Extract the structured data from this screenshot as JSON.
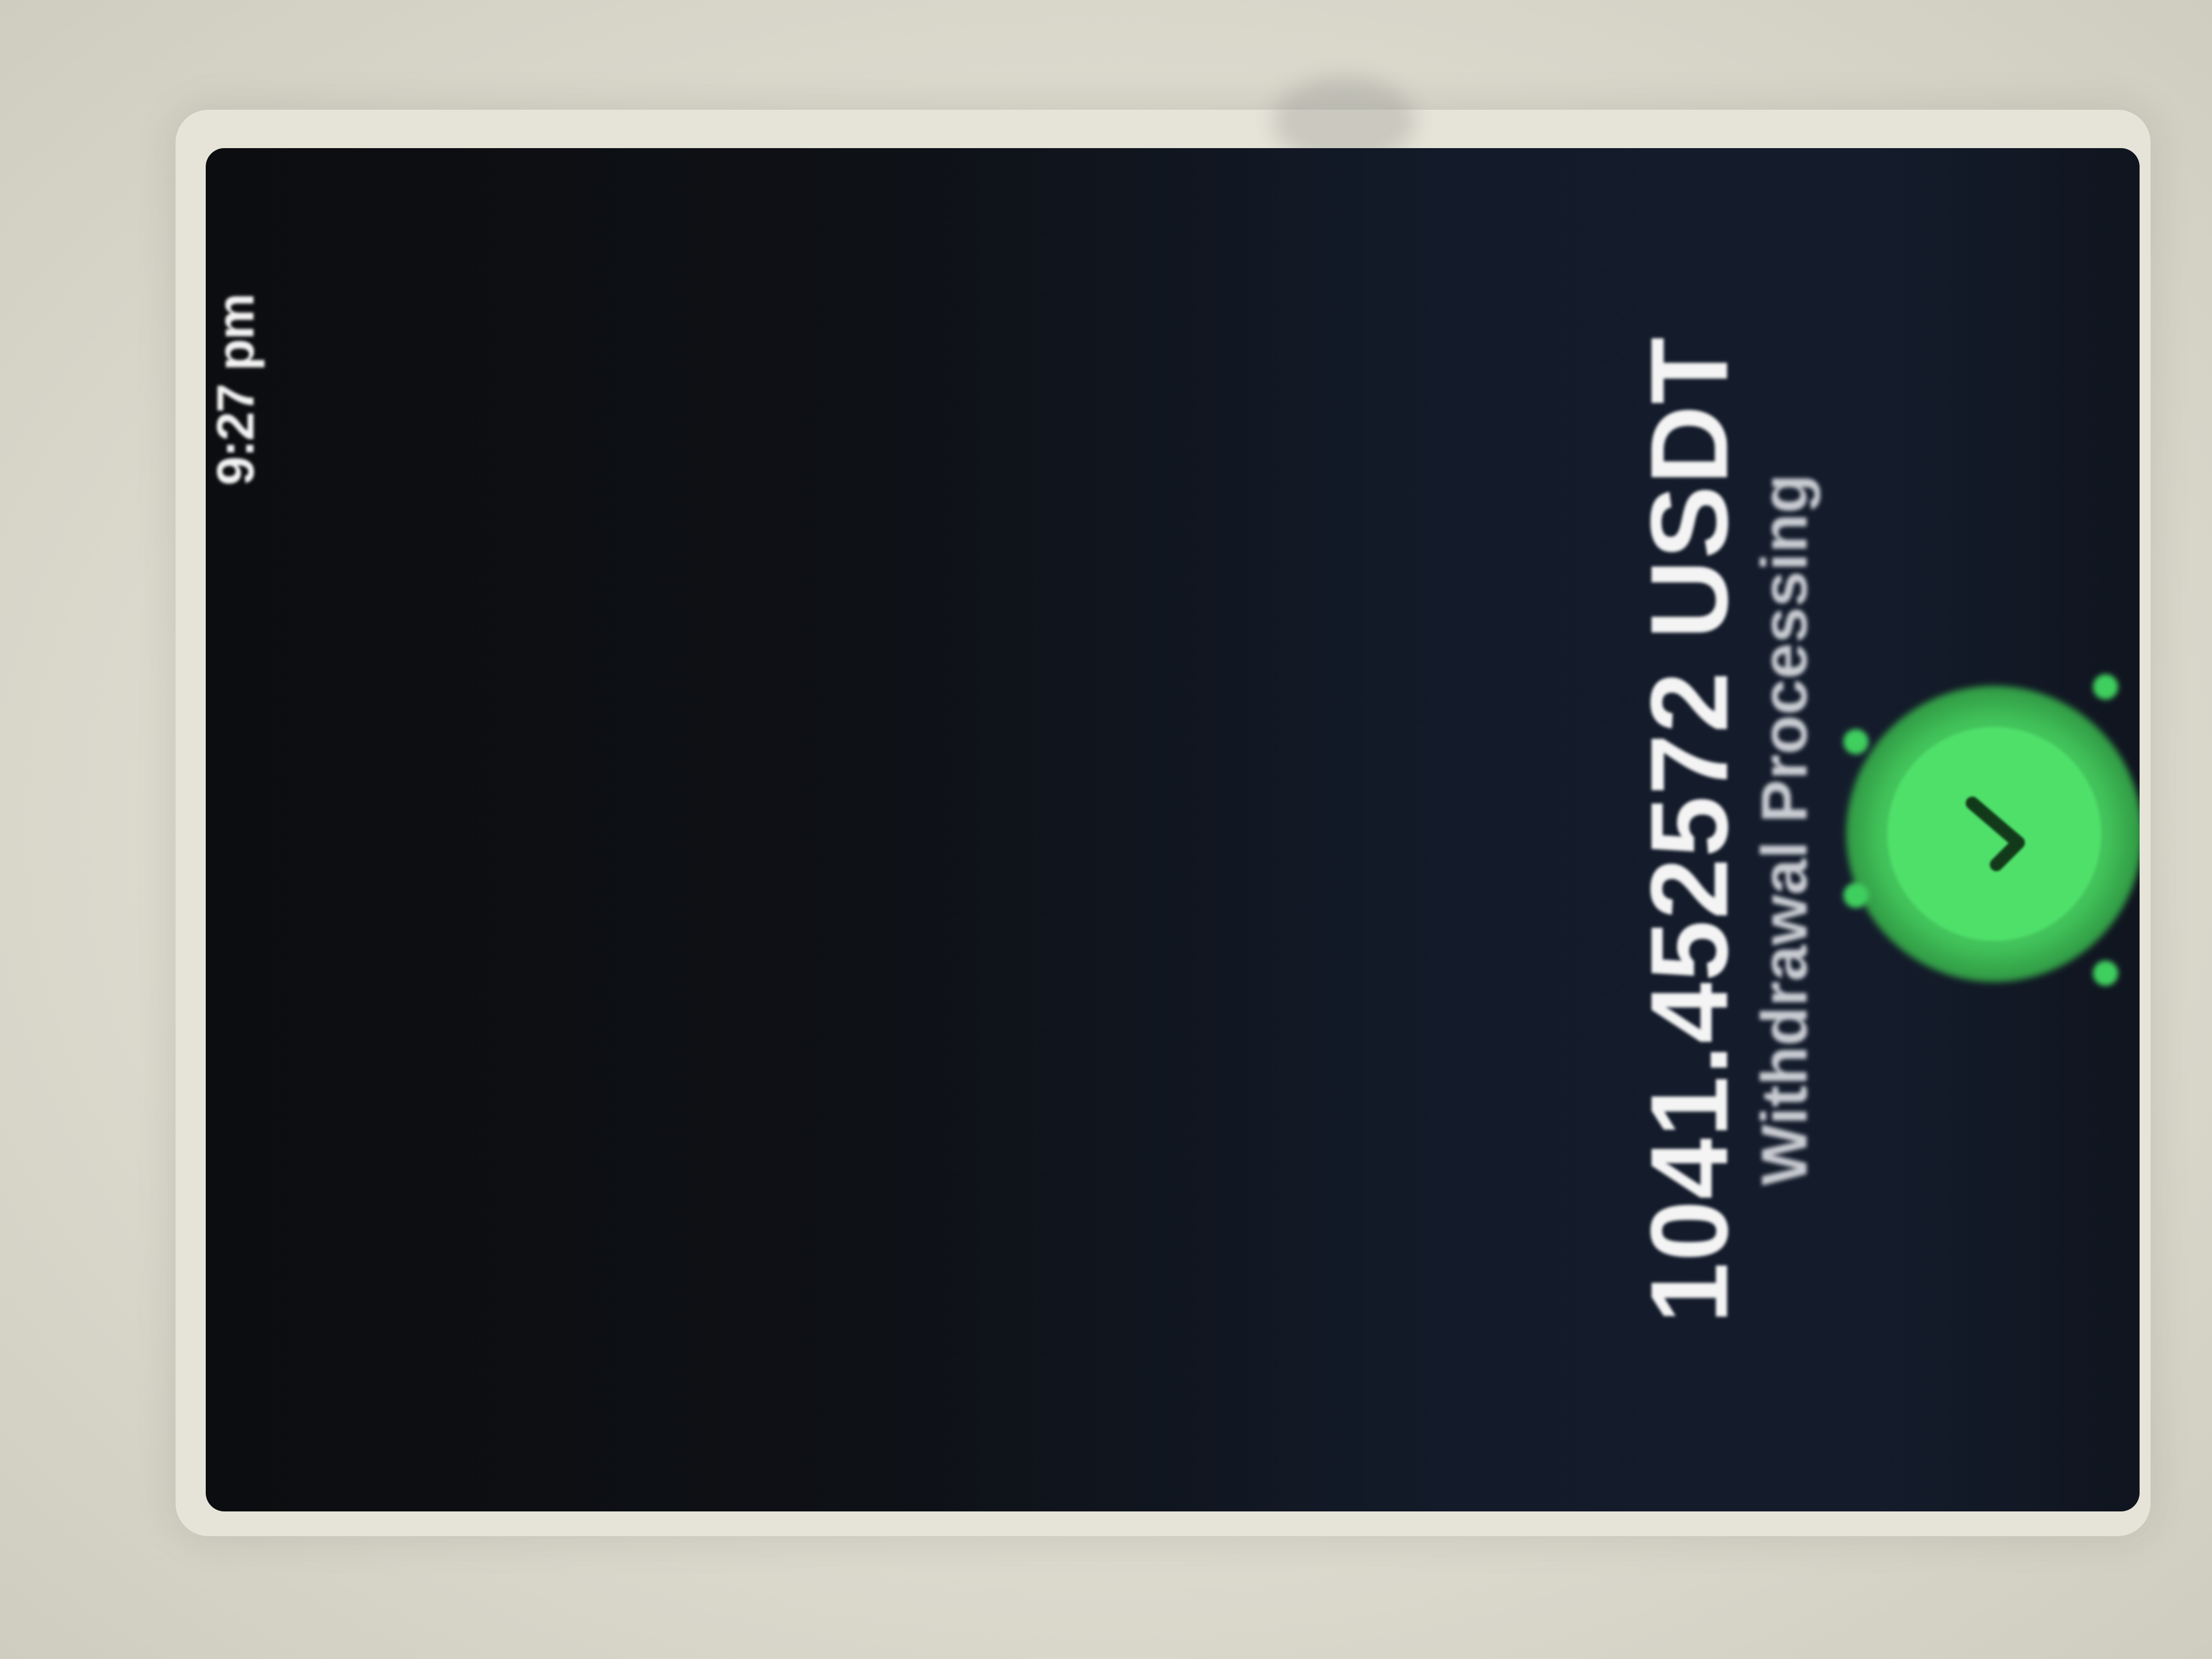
{
  "status_bar": {
    "time": "9:27 pm"
  },
  "result": {
    "icon": "check-icon",
    "title": "Withdrawal Processing",
    "amount": "1041.452572 USDT"
  },
  "colors": {
    "success": "#4fe06a",
    "background": "#131b2a"
  }
}
